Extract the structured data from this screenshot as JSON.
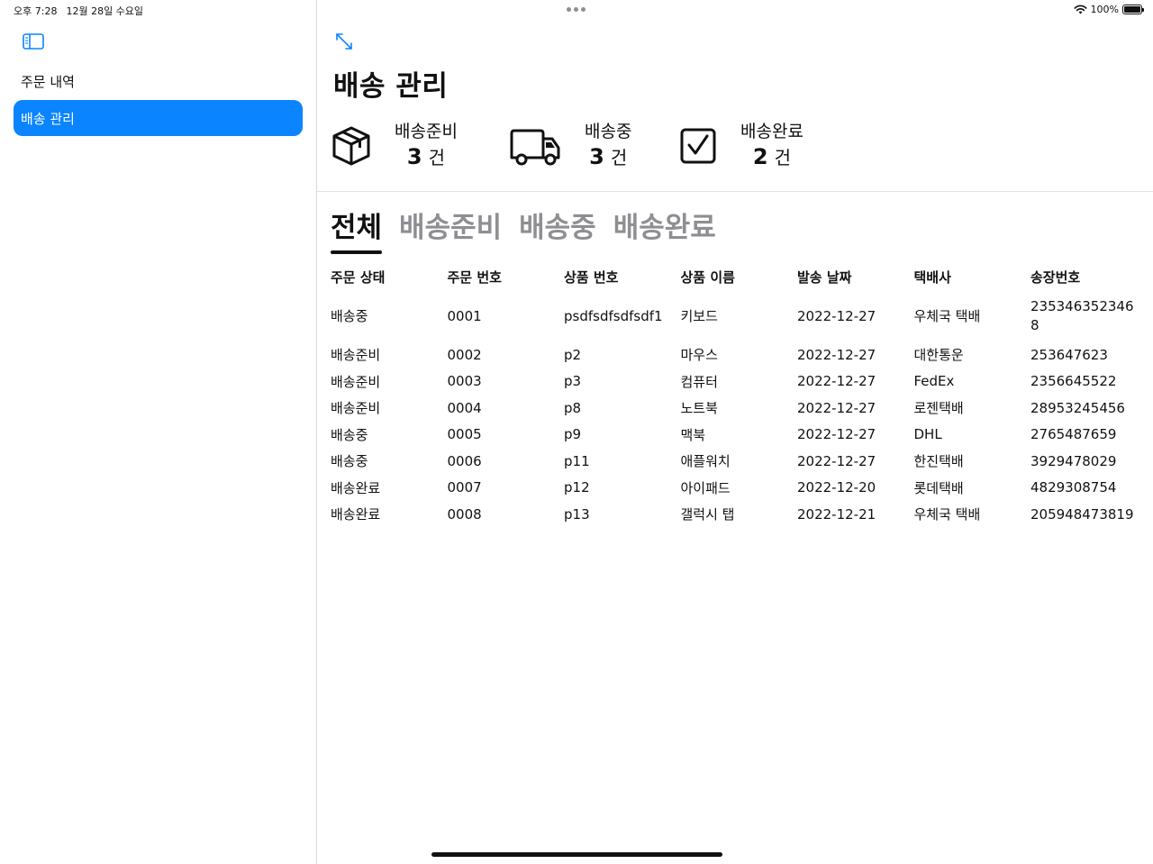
{
  "status_bar": {
    "time": "오후 7:28",
    "date": "12월 28일 수요일",
    "battery": "100%"
  },
  "sidebar": {
    "items": [
      {
        "label": "주문 내역",
        "selected": false
      },
      {
        "label": "배송 관리",
        "selected": true
      }
    ]
  },
  "main": {
    "title": "배송 관리",
    "summary": [
      {
        "label": "배송준비",
        "count": "3",
        "unit": "건",
        "icon": "package-icon"
      },
      {
        "label": "배송중",
        "count": "3",
        "unit": "건",
        "icon": "truck-icon"
      },
      {
        "label": "배송완료",
        "count": "2",
        "unit": "건",
        "icon": "checkbox-icon"
      }
    ],
    "tabs": [
      {
        "label": "전체",
        "active": true
      },
      {
        "label": "배송준비",
        "active": false
      },
      {
        "label": "배송중",
        "active": false
      },
      {
        "label": "배송완료",
        "active": false
      }
    ],
    "table": {
      "headers": [
        "주문 상태",
        "주문 번호",
        "상품 번호",
        "상품 이름",
        "발송 날짜",
        "택배사",
        "송장번호"
      ],
      "rows": [
        [
          "배송중",
          "0001",
          "psdfsdfsdfsdf1",
          "키보드",
          "2022-12-27",
          "우체국 택배",
          "2353463523468"
        ],
        [
          "배송준비",
          "0002",
          "p2",
          "마우스",
          "2022-12-27",
          "대한통운",
          "253647623"
        ],
        [
          "배송준비",
          "0003",
          "p3",
          "컴퓨터",
          "2022-12-27",
          "FedEx",
          "2356645522"
        ],
        [
          "배송준비",
          "0004",
          "p8",
          "노트북",
          "2022-12-27",
          "로젠택배",
          "28953245456"
        ],
        [
          "배송중",
          "0005",
          "p9",
          "맥북",
          "2022-12-27",
          "DHL",
          "2765487659"
        ],
        [
          "배송중",
          "0006",
          "p11",
          "애플워치",
          "2022-12-27",
          "한진택배",
          "3929478029"
        ],
        [
          "배송완료",
          "0007",
          "p12",
          "아이패드",
          "2022-12-20",
          "롯데택배",
          "4829308754"
        ],
        [
          "배송완료",
          "0008",
          "p13",
          "갤럭시 탭",
          "2022-12-21",
          "우체국 택배",
          "205948473819"
        ]
      ]
    }
  },
  "colors": {
    "accent": "#0a84ff",
    "inactive_tab": "#8e8e93",
    "text": "#111111"
  }
}
